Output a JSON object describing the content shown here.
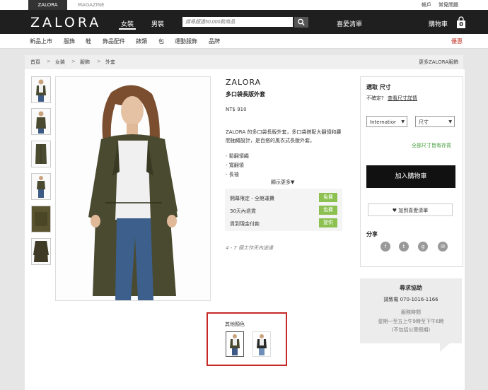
{
  "topbar": {
    "tab_zalora": "ZALORA",
    "tab_magazine": "MAGAZINE",
    "account": "帳戶",
    "faq": "常見問題"
  },
  "header": {
    "logo": "ZALORA",
    "nav_women": "女裝",
    "nav_men": "男裝",
    "search_placeholder": "搜尋超過50,000款商品",
    "wishlist": "喜愛清單",
    "cart": "購物車",
    "cart_count": "0"
  },
  "categories": [
    "新品上市",
    "服飾",
    "鞋",
    "飾品配件",
    "錶類",
    "包",
    "運動服飾",
    "品牌"
  ],
  "sale": "優惠",
  "breadcrumb": [
    "首頁",
    "女裝",
    "服飾",
    "外套"
  ],
  "more_brand": "更多ZALORA服飾",
  "product": {
    "brand": "ZALORA",
    "name": "多口袋長版外套",
    "price": "NT$ 910",
    "description": "ZALORA 的多口袋長版外套，多口袋搭配大翻領和腰間抽繩設計，是百搭的風衣式長版外套。",
    "features": [
      "- 鬆翻領繩",
      "- 寬翻領",
      "- 長袖"
    ],
    "show_more": "顯示更多▼",
    "shipping": "4 - 7 個工作天內送達"
  },
  "perks": [
    {
      "label": "開幕限定 - 全館運費",
      "badge": "免費"
    },
    {
      "label": "30天內退貨",
      "badge": "免費"
    },
    {
      "label": "貨到現金付款",
      "badge": "提供"
    }
  ],
  "buybox": {
    "size_title": "選取 尺寸",
    "size_question": "不確定?",
    "size_guide": "查看尺寸詳情",
    "region_select": "Internatior",
    "size_select": "尺寸",
    "in_stock": "全部尺寸皆有存貨",
    "add_to_cart": "加入購物車",
    "add_to_wishlist": "加到喜愛清單",
    "share_title": "分享"
  },
  "help": {
    "title": "尋求協助",
    "phone": "請致電 070-1016-1166",
    "hours_title": "服務時間",
    "hours": "星期一至五上午9時至下午6時",
    "note": "(不包括公眾假期)"
  },
  "other_colors": {
    "title": "其他顏色"
  },
  "colors": {
    "accent_green": "#8cc152",
    "sale_red": "#c0392b",
    "highlight_red": "#c62828",
    "header_bg": "#1f1f1f"
  }
}
